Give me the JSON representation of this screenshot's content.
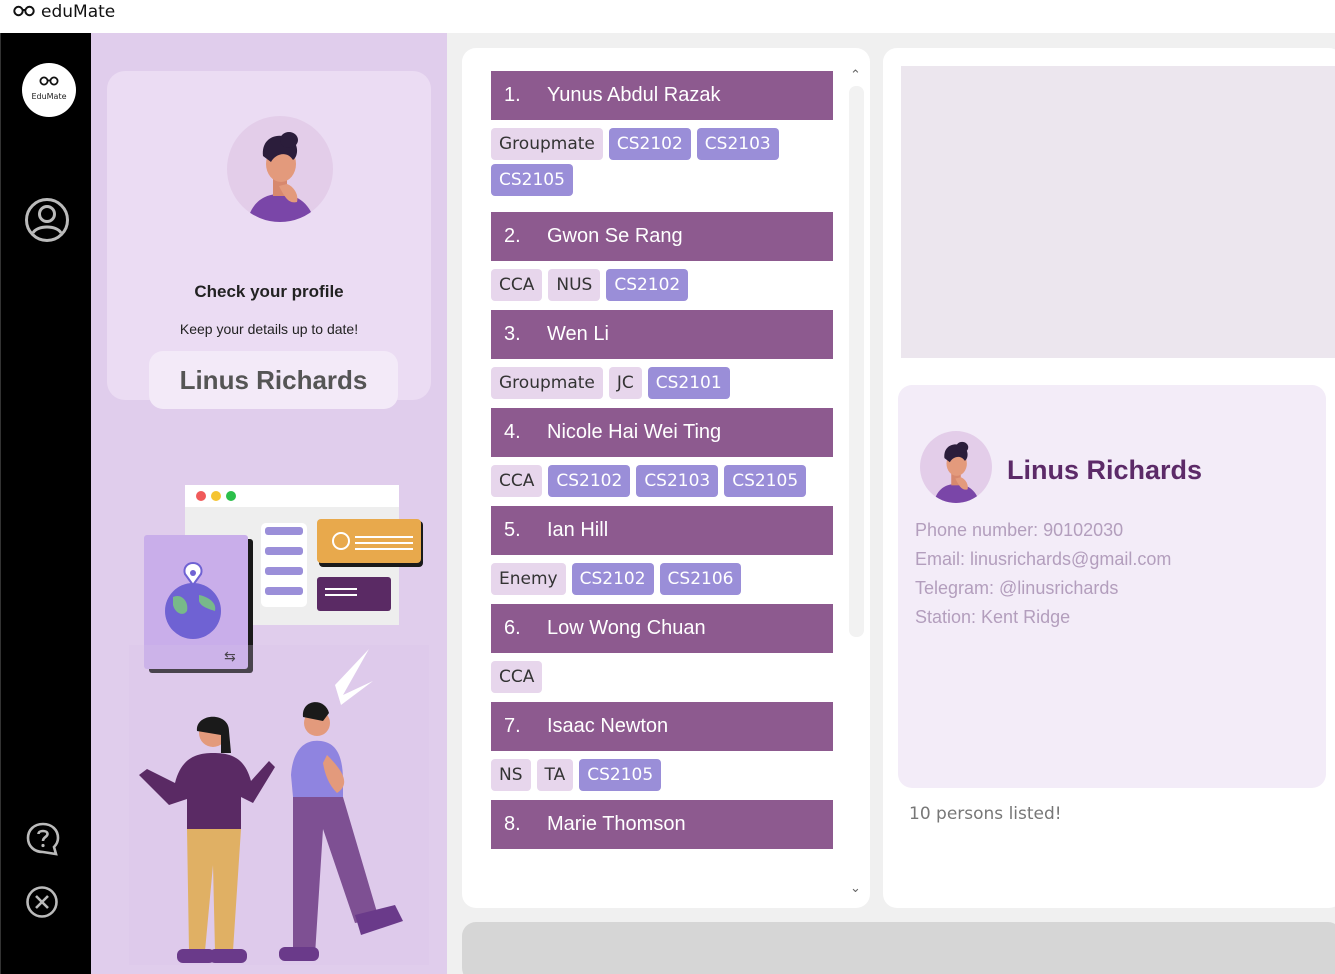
{
  "window": {
    "title": "eduMate"
  },
  "sidebar": {
    "logo_text": "EduMate"
  },
  "profile": {
    "title": "Check your profile",
    "subtitle": "Keep your details up to date!",
    "name": "Linus Richards"
  },
  "contacts": [
    {
      "index": "1.",
      "name": "Yunus Abdul Razak",
      "tags": [
        {
          "label": "Groupmate",
          "kind": "grey"
        },
        {
          "label": "CS2102",
          "kind": "blue"
        },
        {
          "label": "CS2103",
          "kind": "blue"
        },
        {
          "label": "CS2105",
          "kind": "blue"
        }
      ]
    },
    {
      "index": "2.",
      "name": "Gwon Se Rang",
      "tags": [
        {
          "label": "CCA",
          "kind": "grey"
        },
        {
          "label": "NUS",
          "kind": "grey"
        },
        {
          "label": "CS2102",
          "kind": "blue"
        }
      ]
    },
    {
      "index": "3.",
      "name": "Wen Li",
      "tags": [
        {
          "label": "Groupmate",
          "kind": "grey"
        },
        {
          "label": "JC",
          "kind": "grey"
        },
        {
          "label": "CS2101",
          "kind": "blue"
        }
      ]
    },
    {
      "index": "4.",
      "name": "Nicole Hai Wei Ting",
      "tags": [
        {
          "label": "CCA",
          "kind": "grey"
        },
        {
          "label": "CS2102",
          "kind": "blue"
        },
        {
          "label": "CS2103",
          "kind": "blue"
        },
        {
          "label": "CS2105",
          "kind": "blue"
        }
      ]
    },
    {
      "index": "5.",
      "name": "Ian Hill",
      "tags": [
        {
          "label": "Enemy",
          "kind": "grey"
        },
        {
          "label": "CS2102",
          "kind": "blue"
        },
        {
          "label": "CS2106",
          "kind": "blue"
        }
      ]
    },
    {
      "index": "6.",
      "name": "Low Wong Chuan",
      "tags": [
        {
          "label": "CCA",
          "kind": "grey"
        }
      ]
    },
    {
      "index": "7.",
      "name": "Isaac Newton",
      "tags": [
        {
          "label": "NS",
          "kind": "grey"
        },
        {
          "label": "TA",
          "kind": "grey"
        },
        {
          "label": "CS2105",
          "kind": "blue"
        }
      ]
    },
    {
      "index": "8.",
      "name": "Marie Thomson",
      "tags": []
    }
  ],
  "detail": {
    "name": "Linus Richards",
    "phone": "Phone number: 90102030",
    "email": "Email: linusrichards@gmail.com",
    "telegram": "Telegram: @linusrichards",
    "station": "Station: Kent Ridge"
  },
  "status": {
    "count_text": "10 persons listed!"
  },
  "colors": {
    "accent": "#8d5a8f",
    "panel": "#e0cdec",
    "tag_blue": "#9a8ed8",
    "tag_grey": "#e7d6ec",
    "name": "#5c2a68"
  },
  "icons": [
    "glasses-icon",
    "user-circle-icon",
    "help-icon",
    "close-icon",
    "chevron-up-icon",
    "chevron-down-icon"
  ]
}
